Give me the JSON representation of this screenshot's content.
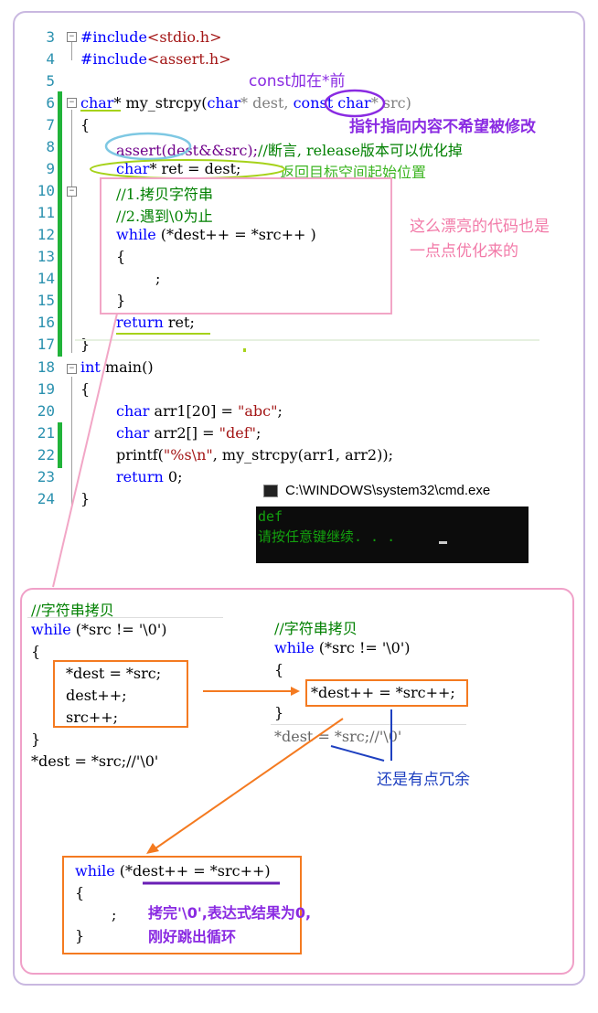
{
  "editor": {
    "lines": [
      {
        "num": "3",
        "text": "#include<stdio.h>"
      },
      {
        "num": "4",
        "text": "#include<assert.h>"
      },
      {
        "num": "5",
        "text": ""
      },
      {
        "num": "6",
        "text": "char* my_strcpy(char* dest, const char* src)"
      },
      {
        "num": "7",
        "text": "{"
      },
      {
        "num": "8",
        "text": "    assert(dest&&src);//断言, release版本可以优化掉"
      },
      {
        "num": "9",
        "text": "    char* ret = dest;"
      },
      {
        "num": "10",
        "text": "    //1.拷贝字符串"
      },
      {
        "num": "11",
        "text": "    //2.遇到\\0为止"
      },
      {
        "num": "12",
        "text": "    while (*dest++ = *src++ )"
      },
      {
        "num": "13",
        "text": "    {"
      },
      {
        "num": "14",
        "text": "        ;"
      },
      {
        "num": "15",
        "text": "    }"
      },
      {
        "num": "16",
        "text": "    return ret;"
      },
      {
        "num": "17",
        "text": "}"
      },
      {
        "num": "18",
        "text": "int main()"
      },
      {
        "num": "19",
        "text": "{"
      },
      {
        "num": "20",
        "text": "    char arr1[20] = \"abc\";"
      },
      {
        "num": "21",
        "text": "    char arr2[] = \"def\";"
      },
      {
        "num": "22",
        "text": "    printf(\"%s\\n\", my_strcpy(arr1, arr2));"
      },
      {
        "num": "23",
        "text": "    return 0;"
      },
      {
        "num": "24",
        "text": "}"
      }
    ],
    "tokens": {
      "include1_kw": "#include",
      "include1_arg": "<stdio.h>",
      "include2_kw": "#include",
      "include2_arg": "<assert.h>",
      "l6_kw1": "char",
      "l6_a": "* my_strcpy(",
      "l6_kw2": "char",
      "l6_b": "* dest, ",
      "l6_kw3": "const",
      "l6_c": " ",
      "l6_kw4": "char",
      "l6_d": "* src)",
      "l7": "{",
      "l8_a": "assert(dest&&src);",
      "l8_cmt": "//断言, release版本可以优化掉",
      "l9_kw": "char",
      "l9_a": "* ret = dest;",
      "l10_cmt": "//1.拷贝字符串",
      "l11_cmt": "//2.遇到\\0为止",
      "l12_kw": "while",
      "l12_a": " (*dest++ = *src++ )",
      "l13": "{",
      "l14": ";",
      "l15": "}",
      "l16_kw": "return",
      "l16_a": " ret;",
      "l17": "}",
      "l18_kw": "int",
      "l18_a": " main()",
      "l19": "{",
      "l20_kw": "char",
      "l20_a": " arr1[20] = ",
      "l20_str": "\"abc\"",
      "l20_b": ";",
      "l21_kw": "char",
      "l21_a": " arr2[] = ",
      "l21_str": "\"def\"",
      "l21_b": ";",
      "l22_a": "printf(",
      "l22_str": "\"%s\\n\"",
      "l22_b": ", my_strcpy(arr1, arr2));",
      "l23_kw": "return",
      "l23_a": " 0;",
      "l24": "}"
    }
  },
  "annotations": {
    "const_position": "const加在*前",
    "const_meaning": "指针指向内容不希望被修改",
    "return_start": "返回目标空间起始位置",
    "optimized": "这么漂亮的代码也是\n一点点优化来的",
    "redundant": "还是有点冗余",
    "loop_explain": "拷完'\\0',表达式结果为0,\n刚好跳出循环"
  },
  "console": {
    "title": "C:\\WINDOWS\\system32\\cmd.exe",
    "output_line1": "def",
    "output_line2": "请按任意键继续. . . "
  },
  "snippet1": {
    "comment": "//字符串拷贝",
    "while_kw": "while",
    "while_cond": " (*src != '\\0')",
    "open": "{",
    "body1": "*dest = *src;",
    "body2": "dest++;",
    "body3": "src++;",
    "close": "}",
    "after": "*dest = *src;//'\\0'"
  },
  "snippet2": {
    "comment": "//字符串拷贝",
    "while_kw": "while",
    "while_cond": " (*src != '\\0')",
    "open": "{",
    "body": "*dest++ = *src++;",
    "close": "}",
    "after": "*dest = *src;//'\\0'"
  },
  "snippet3": {
    "while_kw": "while",
    "while_cond": " (*dest++ = *src++)",
    "open": "{",
    "body": ";",
    "close": "}"
  },
  "colors": {
    "keyword": "#0000ff",
    "comment": "#008000",
    "string": "#a31515",
    "purple_note": "#8a2be2",
    "blue_note": "#1e90ff",
    "green_note": "#3cb521",
    "pink_note": "#f27aa8",
    "orange_box": "#f47a20",
    "console_bg": "#0c0c0c",
    "console_text": "#13a10e"
  }
}
